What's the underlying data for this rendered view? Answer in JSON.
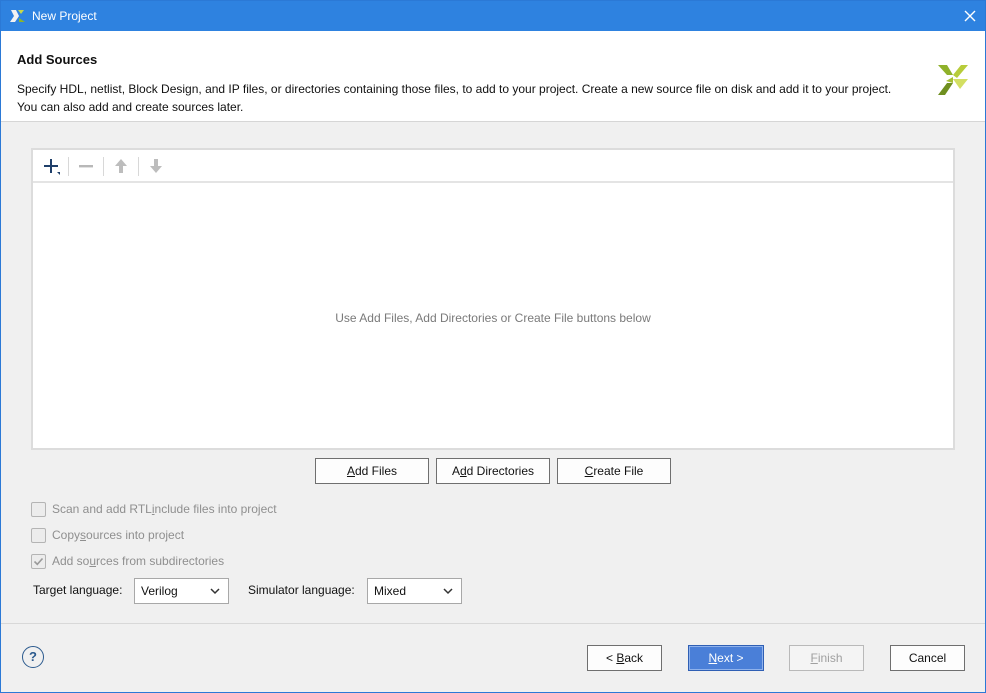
{
  "window": {
    "title": "New Project",
    "accent_color": "#2e82e0",
    "icons": {
      "app": "vivado-logo-icon",
      "close": "close-icon"
    }
  },
  "header": {
    "heading": "Add Sources",
    "description_line1": "Specify HDL, netlist, Block Design, and IP files, or directories containing those files, to add to your project. Create a new source file on disk and add it to your project.",
    "description_line2": "You can also add and create sources later.",
    "logo_icon": "xilinx-logo-icon"
  },
  "sources_panel": {
    "toolbar": {
      "add_icon": "plus-icon",
      "remove_icon": "minus-icon",
      "move_up_icon": "arrow-up-icon",
      "move_down_icon": "arrow-down-icon"
    },
    "empty_message": "Use Add Files, Add Directories or Create File buttons below"
  },
  "actions": {
    "add_files": {
      "pre": "",
      "mn": "A",
      "post": "dd Files"
    },
    "add_directories": {
      "pre": "A",
      "mn": "d",
      "post": "d Directories"
    },
    "create_file": {
      "pre": "",
      "mn": "C",
      "post": "reate File"
    }
  },
  "options": [
    {
      "pre": "Scan and add RTL ",
      "mn": "i",
      "post": "nclude files into project",
      "checked": false,
      "enabled": false
    },
    {
      "pre": "Copy ",
      "mn": "s",
      "post": "ources into project",
      "checked": false,
      "enabled": false
    },
    {
      "pre": "Add so",
      "mn": "u",
      "post": "rces from subdirectories",
      "checked": true,
      "enabled": false
    }
  ],
  "language": {
    "target_label": "Target language:",
    "target_value": "Verilog",
    "simulator_label": "Simulator language:",
    "simulator_value": "Mixed"
  },
  "footer": {
    "help_label": "?",
    "back": {
      "pre": "< ",
      "mn": "B",
      "post": "ack"
    },
    "next": {
      "pre": "",
      "mn": "N",
      "post": "ext >"
    },
    "finish": {
      "pre": "",
      "mn": "F",
      "post": "inish"
    },
    "cancel": "Cancel"
  }
}
